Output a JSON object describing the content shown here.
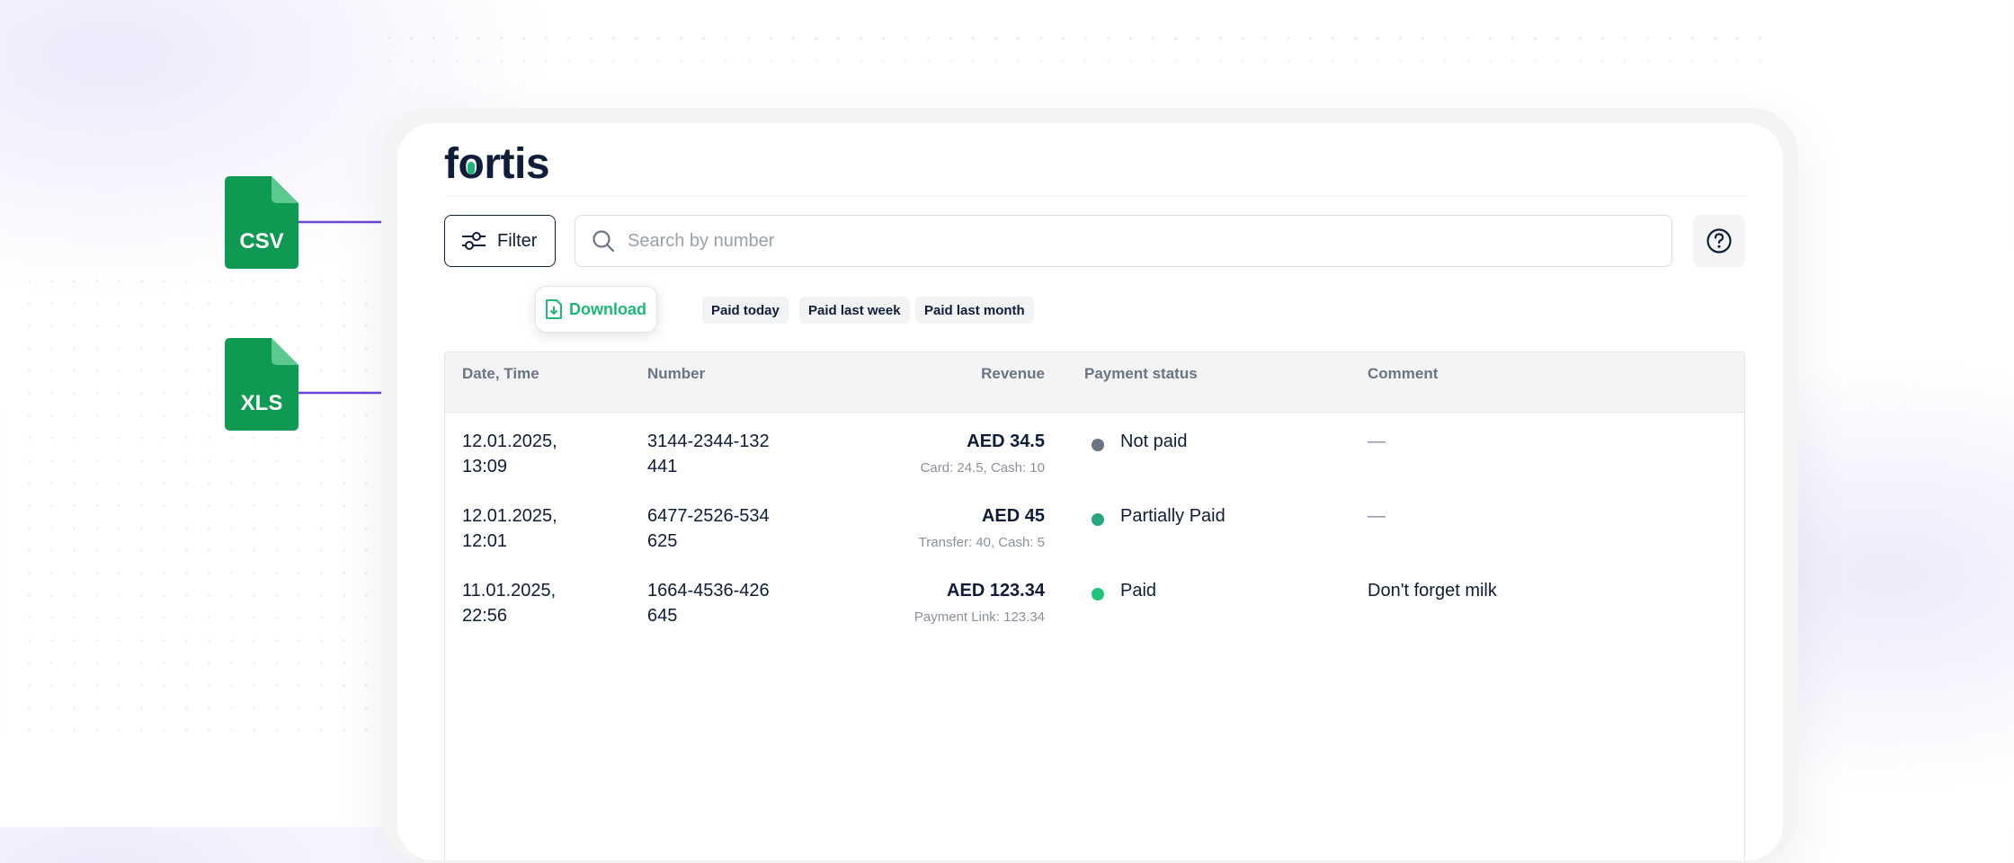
{
  "app": {
    "logo": "fortis"
  },
  "toolbar": {
    "filter_label": "Filter",
    "search_placeholder": "Search by number"
  },
  "download": {
    "label": "Download"
  },
  "quick_filters": [
    {
      "label": "Paid today"
    },
    {
      "label": "Paid last week"
    },
    {
      "label": "Paid last month"
    }
  ],
  "table": {
    "headers": {
      "datetime": "Date, Time",
      "number": "Number",
      "revenue": "Revenue",
      "status": "Payment status",
      "comment": "Comment"
    },
    "rows": [
      {
        "date": "12.01.2025,",
        "time": "13:09",
        "number_a": "3144-2344-132",
        "number_b": "441",
        "revenue": "AED 34.5",
        "revenue_detail": "Card: 24.5, Cash: 10",
        "status": "Not paid",
        "status_color": "#6b7485",
        "comment": "—"
      },
      {
        "date": "12.01.2025,",
        "time": "12:01",
        "number_a": "6477-2526-534",
        "number_b": "625",
        "revenue": "AED 45",
        "revenue_detail": "Transfer: 40, Cash: 5",
        "status": "Partially Paid",
        "status_color": "#27a680",
        "comment": "—"
      },
      {
        "date": "11.01.2025,",
        "time": "22:56",
        "number_a": "1664-4536-426",
        "number_b": "645",
        "revenue": "AED 123.34",
        "revenue_detail": "Payment Link: 123.34",
        "status": "Paid",
        "status_color": "#1fc37c",
        "comment": "Don't forget milk"
      }
    ]
  },
  "export_formats": [
    {
      "label": "CSV",
      "icon": "file-csv-icon"
    },
    {
      "label": "XLS",
      "icon": "file-xls-icon"
    }
  ],
  "colors": {
    "brand_dark": "#0f1d3a",
    "accent_green": "#1db877",
    "file_green": "#0e9a52",
    "connector_purple": "#6c45d9"
  }
}
